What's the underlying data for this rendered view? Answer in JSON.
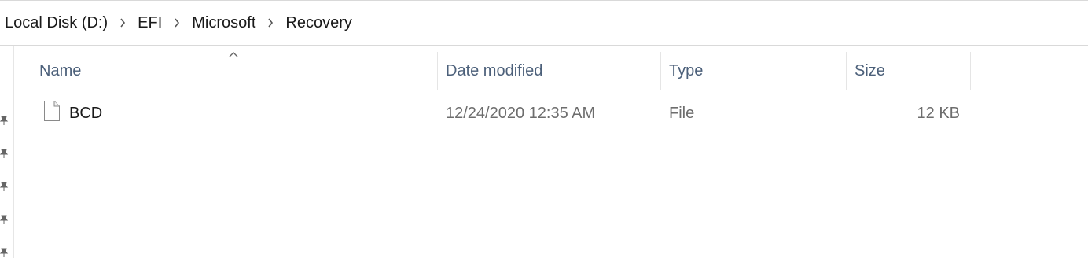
{
  "breadcrumb": {
    "items": [
      {
        "label": "Local Disk (D:)"
      },
      {
        "label": "EFI"
      },
      {
        "label": "Microsoft"
      },
      {
        "label": "Recovery"
      }
    ]
  },
  "columns": {
    "name": "Name",
    "date_modified": "Date modified",
    "type": "Type",
    "size": "Size",
    "sort_column": "Name",
    "sort_direction": "ascending"
  },
  "files": [
    {
      "icon": "generic-file-icon",
      "name": "BCD",
      "date_modified": "12/24/2020 12:35 AM",
      "type": "File",
      "size": "12 KB"
    }
  ],
  "colors": {
    "header_text": "#4c607a",
    "secondary_text": "#6d6d6d",
    "primary_text": "#1a1a1a"
  }
}
